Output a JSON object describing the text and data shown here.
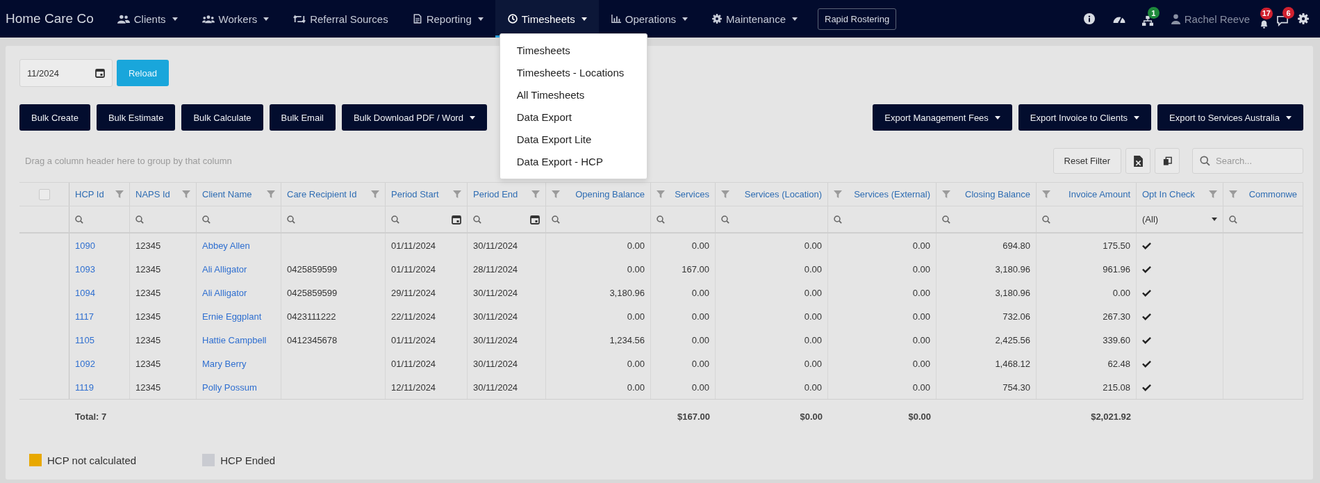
{
  "navbar": {
    "brand": "Home Care Co",
    "items": [
      {
        "label": "Clients",
        "dropdown": true,
        "selected": false
      },
      {
        "label": "Workers",
        "dropdown": true,
        "selected": false
      },
      {
        "label": "Referral Sources",
        "dropdown": false,
        "selected": false
      },
      {
        "label": "Reporting",
        "dropdown": true,
        "selected": false
      },
      {
        "label": "Timesheets",
        "dropdown": true,
        "selected": true,
        "menu": [
          "Timesheets",
          "Timesheets - Locations",
          "All Timesheets",
          "Data Export",
          "Data Export Lite",
          "Data Export - HCP"
        ]
      },
      {
        "label": "Operations",
        "dropdown": true,
        "selected": false
      },
      {
        "label": "Maintenance",
        "dropdown": true,
        "selected": false
      }
    ],
    "rapid_rostering_button": "Rapid Rostering",
    "network_badge": "1",
    "user_name": "Rachel Reeve",
    "notifications_badge": "17",
    "messages_badge": "6"
  },
  "period_field": {
    "value": "11/2024"
  },
  "reload_button": "Reload",
  "bulk_buttons": [
    {
      "label": "Bulk Create",
      "dropdown": false
    },
    {
      "label": "Bulk Estimate",
      "dropdown": false
    },
    {
      "label": "Bulk Calculate",
      "dropdown": false
    },
    {
      "label": "Bulk Email",
      "dropdown": false
    },
    {
      "label": "Bulk Download PDF / Word",
      "dropdown": true
    }
  ],
  "export_buttons": [
    {
      "label": "Export Management Fees",
      "dropdown": true
    },
    {
      "label": "Export Invoice to Clients",
      "dropdown": true
    },
    {
      "label": "Export to Services Australia",
      "dropdown": true
    }
  ],
  "grid": {
    "group_panel_hint": "Drag a column header here to group by that column",
    "reset_filter_button": "Reset Filter",
    "search": {
      "placeholder": "Search..."
    },
    "select_all": {
      "checked": false
    },
    "columns": [
      {
        "label": "HCP Id",
        "kind": "link"
      },
      {
        "label": "NAPS Id",
        "kind": "text"
      },
      {
        "label": "Client Name",
        "kind": "link"
      },
      {
        "label": "Care Recipient Id",
        "kind": "text"
      },
      {
        "label": "Period Start",
        "kind": "date"
      },
      {
        "label": "Period End",
        "kind": "date"
      },
      {
        "label": "Opening Balance",
        "kind": "number"
      },
      {
        "label": "Services",
        "kind": "number"
      },
      {
        "label": "Services (Location)",
        "kind": "number"
      },
      {
        "label": "Services (External)",
        "kind": "number"
      },
      {
        "label": "Closing Balance",
        "kind": "number"
      },
      {
        "label": "Invoice Amount",
        "kind": "number"
      },
      {
        "label": "Opt In Check",
        "kind": "check",
        "filter_value": "(All)"
      },
      {
        "label": "Commonwe",
        "kind": "number"
      }
    ],
    "rows": [
      {
        "hcp_id": "1090",
        "naps_id": "12345",
        "client_name": "Abbey Allen",
        "period_start": "01/11/2024",
        "period_end": "30/11/2024",
        "opening_balance": "0.00",
        "services": "0.00",
        "services_location": "0.00",
        "services_external": "0.00",
        "closing_balance": "694.80",
        "invoice_amount": "175.50",
        "opt_in_check": true
      },
      {
        "hcp_id": "1093",
        "naps_id": "12345",
        "client_name": "Ali Alligator",
        "care_recipient_id": "0425859599",
        "period_start": "01/11/2024",
        "period_end": "28/11/2024",
        "opening_balance": "0.00",
        "services": "167.00",
        "services_location": "0.00",
        "services_external": "0.00",
        "closing_balance": "3,180.96",
        "invoice_amount": "961.96",
        "opt_in_check": true
      },
      {
        "hcp_id": "1094",
        "naps_id": "12345",
        "client_name": "Ali Alligator",
        "care_recipient_id": "0425859599",
        "period_start": "29/11/2024",
        "period_end": "30/11/2024",
        "opening_balance": "3,180.96",
        "services": "0.00",
        "services_location": "0.00",
        "services_external": "0.00",
        "closing_balance": "3,180.96",
        "invoice_amount": "0.00",
        "opt_in_check": true
      },
      {
        "hcp_id": "1117",
        "naps_id": "12345",
        "client_name": "Ernie Eggplant",
        "care_recipient_id": "0423111222",
        "period_start": "22/11/2024",
        "period_end": "30/11/2024",
        "opening_balance": "0.00",
        "services": "0.00",
        "services_location": "0.00",
        "services_external": "0.00",
        "closing_balance": "732.06",
        "invoice_amount": "267.30",
        "opt_in_check": true
      },
      {
        "hcp_id": "1105",
        "naps_id": "12345",
        "client_name": "Hattie Campbell",
        "care_recipient_id": "0412345678",
        "period_start": "01/11/2024",
        "period_end": "30/11/2024",
        "opening_balance": "1,234.56",
        "services": "0.00",
        "services_location": "0.00",
        "services_external": "0.00",
        "closing_balance": "2,425.56",
        "invoice_amount": "339.60",
        "opt_in_check": true
      },
      {
        "hcp_id": "1092",
        "naps_id": "12345",
        "client_name": "Mary Berry",
        "period_start": "01/11/2024",
        "period_end": "30/11/2024",
        "opening_balance": "0.00",
        "services": "0.00",
        "services_location": "0.00",
        "services_external": "0.00",
        "closing_balance": "1,468.12",
        "invoice_amount": "62.48",
        "opt_in_check": true
      },
      {
        "hcp_id": "1119",
        "naps_id": "12345",
        "client_name": "Polly Possum",
        "period_start": "12/11/2024",
        "period_end": "30/11/2024",
        "opening_balance": "0.00",
        "services": "0.00",
        "services_location": "0.00",
        "services_external": "0.00",
        "closing_balance": "754.30",
        "invoice_amount": "215.08",
        "opt_in_check": true
      }
    ],
    "totals": {
      "hcp_id": "Total: 7",
      "services": "$167.00",
      "services_location": "$0.00",
      "services_external": "$0.00",
      "invoice_amount": "$2,021.92"
    }
  },
  "legend": [
    {
      "label": "HCP not calculated",
      "color": "#e8a800"
    },
    {
      "label": "HCP Ended",
      "color": "#c9cbd1"
    }
  ]
}
